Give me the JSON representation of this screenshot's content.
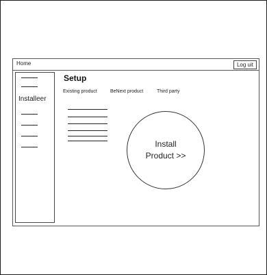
{
  "topbar": {
    "home_label": "Home",
    "logout_label": "Log uit"
  },
  "sidebar": {
    "label": "Installeer"
  },
  "main": {
    "title": "Setup",
    "tabs": [
      {
        "label": "Existing product"
      },
      {
        "label": "BeNext product"
      },
      {
        "label": "Third party"
      }
    ],
    "install_button_label": "Install\nProduct >>"
  }
}
